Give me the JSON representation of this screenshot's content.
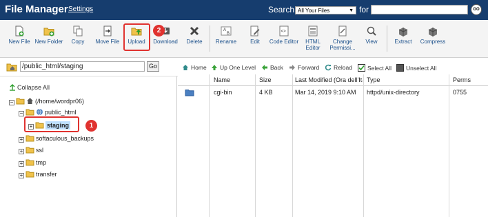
{
  "header": {
    "title": "File Manager",
    "settings_label": "Settings",
    "search_label": "Search",
    "search_scope": "All Your Files",
    "for_label": "for",
    "search_value": "",
    "go_label": "GO"
  },
  "toolbar": {
    "items": [
      {
        "label": "New File",
        "icon": "new-file-icon"
      },
      {
        "label": "New Folder",
        "icon": "new-folder-icon"
      },
      {
        "label": "Copy",
        "icon": "copy-icon"
      },
      {
        "label": "Move File",
        "icon": "move-file-icon"
      },
      {
        "label": "Upload",
        "icon": "upload-icon"
      },
      {
        "label": "Download",
        "icon": "download-icon"
      },
      {
        "label": "Delete",
        "icon": "delete-icon"
      },
      {
        "label": "Rename",
        "icon": "rename-icon"
      },
      {
        "label": "Edit",
        "icon": "edit-icon"
      },
      {
        "label": "Code Editor",
        "icon": "code-editor-icon"
      },
      {
        "label": "HTML Editor",
        "icon": "html-editor-icon"
      },
      {
        "label": "Change Permissi...",
        "icon": "permissions-icon"
      },
      {
        "label": "View",
        "icon": "view-icon"
      },
      {
        "label": "Extract",
        "icon": "extract-icon"
      },
      {
        "label": "Compress",
        "icon": "compress-icon"
      }
    ]
  },
  "annotations": {
    "badge_upload": "2",
    "badge_staging": "1",
    "highlight_color": "#e0322f"
  },
  "path": {
    "value": "/public_html/staging",
    "go_label": "Go"
  },
  "nav": {
    "home": "Home",
    "up_one_level": "Up One Level",
    "back": "Back",
    "forward": "Forward",
    "reload": "Reload",
    "select_all": "Select All",
    "unselect_all": "Unselect All"
  },
  "tree": {
    "collapse_all": "Collapse All",
    "root": "(/home/wordpr06)",
    "public_html": "public_html",
    "staging": "staging",
    "softaculous_backups": "softaculous_backups",
    "ssl": "ssl",
    "tmp": "tmp",
    "transfer": "transfer"
  },
  "table": {
    "columns": [
      "Name",
      "Size",
      "Last Modified (Ora dell'Italia)",
      "Type",
      "Perms"
    ],
    "rows": [
      {
        "name": "cgi-bin",
        "size": "4 KB",
        "modified": "Mar 14, 2019 9:10 AM",
        "type": "httpd/unix-directory",
        "perms": "0755"
      }
    ]
  },
  "colors": {
    "header_bg": "#163d6e",
    "toolbar_label": "#1a4f8a",
    "folder": "#f0c24b",
    "folder_blue": "#4a7fc1"
  }
}
